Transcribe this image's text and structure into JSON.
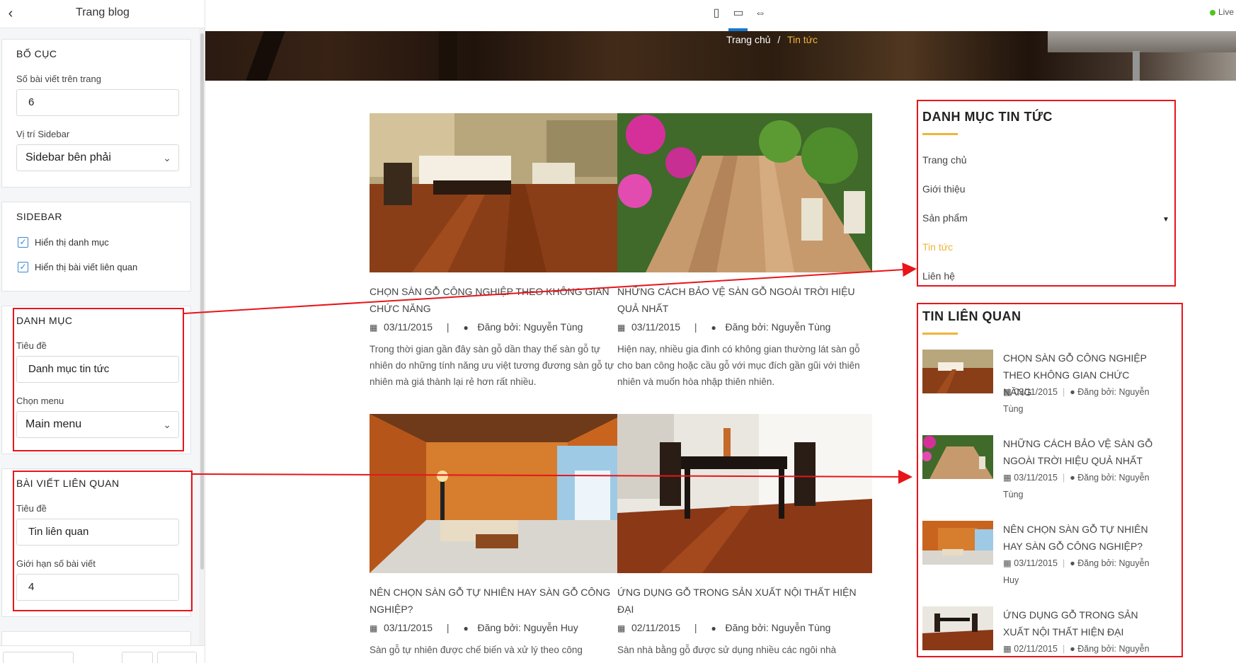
{
  "editor": {
    "title": "Trang blog",
    "layout": {
      "title": "BỐ CỤC",
      "posts_label": "Số bài viết trên trang",
      "posts_value": "6",
      "sidebar_pos_label": "Vị trí Sidebar",
      "sidebar_pos_value": "Sidebar bên phải"
    },
    "sidebar": {
      "title": "SIDEBAR",
      "show_categories": "Hiển thị danh mục",
      "show_related": "Hiển thị bài viết liên quan"
    },
    "category": {
      "title": "DANH MỤC",
      "title_label": "Tiêu đề",
      "title_value": "Danh mục tin tức",
      "menu_label": "Chọn menu",
      "menu_value": "Main menu"
    },
    "related": {
      "title": "BÀI VIẾT LIÊN QUAN",
      "title_label": "Tiêu đề",
      "title_value": "Tin liên quan",
      "limit_label": "Giới hạn số bài viết",
      "limit_value": "4"
    }
  },
  "topbar": {
    "live_label": "Live",
    "device_icons": [
      "mobile-icon",
      "desktop-icon",
      "fullwidth-icon"
    ]
  },
  "breadcrumb": {
    "home": "Trang chủ",
    "separator": "/",
    "current": "Tin tức"
  },
  "posts": [
    {
      "title": "CHỌN SÀN GỖ CÔNG NGHIỆP THEO KHÔNG GIAN CHỨC NĂNG",
      "date": "03/11/2015",
      "author": "Đăng bởi: Nguyễn Tùng",
      "excerpt": "Trong thời gian gần đây sàn gỗ dần thay thế sàn gỗ tự nhiên do những tính năng ưu việt tương đương sàn gỗ tự nhiên mà giá thành lại rẻ hơn rất nhiều."
    },
    {
      "title": "NHỮNG CÁCH BẢO VỆ SÀN GỖ NGOÀI TRỜI HIỆU QUẢ NHẤT",
      "date": "03/11/2015",
      "author": "Đăng bởi: Nguyễn Tùng",
      "excerpt": "Hiện nay, nhiều gia đình có không gian thường lát sàn gỗ cho ban công hoặc cầu gỗ với mục đích gần gũi với thiên nhiên và muốn hòa nhập thiên nhiên."
    },
    {
      "title": "NÊN CHỌN SÀN GỖ TỰ NHIÊN HAY SÀN GỖ CÔNG NGHIỆP?",
      "date": "03/11/2015",
      "author": "Đăng bởi: Nguyễn Huy",
      "excerpt": "Sàn gỗ tự nhiên được chế biến và xử lý theo công"
    },
    {
      "title": "ỨNG DỤNG GỖ TRONG SẢN XUẤT NỘI THẤT HIỆN ĐẠI",
      "date": "02/11/2015",
      "author": "Đăng bởi: Nguyễn Tùng",
      "excerpt": "Sàn nhà bằng gỗ được sử dụng nhiều các ngôi nhà"
    }
  ],
  "sidebar": {
    "categories": {
      "title": "DANH MỤC TIN TỨC",
      "items": [
        "Trang chủ",
        "Giới thiệu",
        "Sản phẩm",
        "Tin tức",
        "Liên hệ"
      ]
    },
    "related": {
      "title": "TIN LIÊN QUAN",
      "items": [
        {
          "title": "CHỌN SÀN GỖ CÔNG NGHIỆP THEO KHÔNG GIAN CHỨC NĂNG",
          "date": "03/11/2015",
          "author": "Đăng bởi: Nguyễn Tùng"
        },
        {
          "title": "NHỮNG CÁCH BẢO VỆ SÀN GỖ NGOÀI TRỜI HIỆU QUẢ NHẤT",
          "date": "03/11/2015",
          "author": "Đăng bởi: Nguyễn Tùng"
        },
        {
          "title": "NÊN CHỌN SÀN GỖ TỰ NHIÊN HAY SÀN GỖ CÔNG NGHIỆP?",
          "date": "03/11/2015",
          "author": "Đăng bởi: Nguyễn Huy"
        },
        {
          "title": "ỨNG DỤNG GỖ TRONG SẢN XUẤT NỘI THẤT HIỆN ĐẠI",
          "date": "02/11/2015",
          "author": "Đăng bởi: Nguyễn"
        }
      ]
    }
  },
  "colors": {
    "accent": "#f0b33a",
    "annotation": "#e8151a",
    "checkbox": "#3b86d6",
    "live": "#52c41a"
  }
}
